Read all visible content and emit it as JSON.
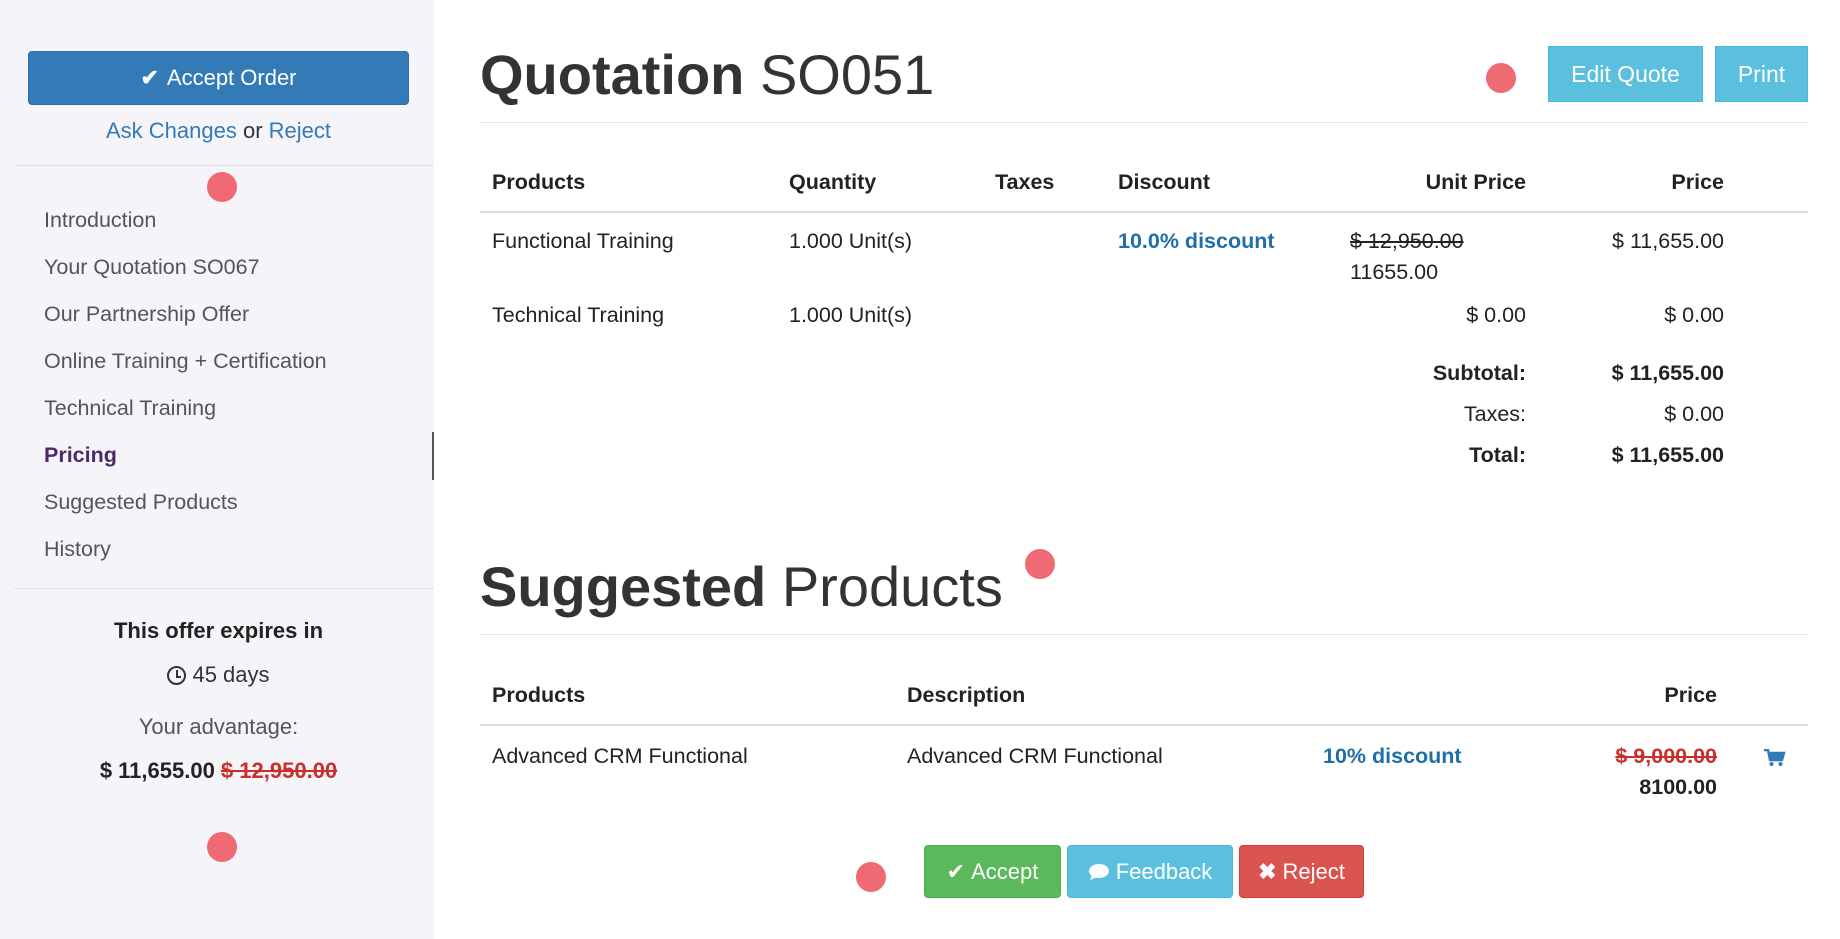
{
  "sidebar": {
    "accept_order_label": "Accept Order",
    "ask_changes_label": "Ask Changes",
    "or_text": "or",
    "reject_link_label": "Reject",
    "nav": [
      {
        "label": "Introduction",
        "active": false
      },
      {
        "label": "Your Quotation SO067",
        "active": false
      },
      {
        "label": "Our Partnership Offer",
        "active": false
      },
      {
        "label": "Online Training + Certification",
        "active": false
      },
      {
        "label": "Technical Training",
        "active": false
      },
      {
        "label": "Pricing",
        "active": true
      },
      {
        "label": "Suggested Products",
        "active": false
      },
      {
        "label": "History",
        "active": false
      }
    ],
    "expires_title": "This offer expires in",
    "expires_days": "45 days",
    "advantage_label": "Your advantage:",
    "price_now": "$ 11,655.00",
    "price_old": "$ 12,950.00"
  },
  "header": {
    "title_bold": "Quotation",
    "title_rest": "SO051",
    "edit_quote_label": "Edit Quote",
    "print_label": "Print"
  },
  "quote_table": {
    "columns": [
      "Products",
      "Quantity",
      "Taxes",
      "Discount",
      "Unit Price",
      "Price"
    ],
    "rows": [
      {
        "product": "Functional Training",
        "quantity": "1.000 Unit(s)",
        "taxes": "",
        "discount": "10.0% discount",
        "unit_price_old": "$ 12,950.00",
        "unit_price": "11655.00",
        "price": "$ 11,655.00"
      },
      {
        "product": "Technical Training",
        "quantity": "1.000 Unit(s)",
        "taxes": "",
        "discount": "",
        "unit_price_old": "",
        "unit_price": "$ 0.00",
        "price": "$ 0.00"
      }
    ],
    "subtotal_label": "Subtotal:",
    "subtotal": "$ 11,655.00",
    "taxes_label": "Taxes:",
    "taxes": "$ 0.00",
    "total_label": "Total:",
    "total": "$ 11,655.00"
  },
  "suggested": {
    "title_bold": "Suggested",
    "title_rest": "Products",
    "columns": [
      "Products",
      "Description",
      "Price"
    ],
    "rows": [
      {
        "product": "Advanced CRM Functional",
        "description": "Advanced CRM Functional",
        "discount": "10% discount",
        "price_old": "$ 9,000.00",
        "price": "8100.00"
      }
    ]
  },
  "actions": {
    "accept_label": "Accept",
    "feedback_label": "Feedback",
    "reject_label": "Reject"
  },
  "colors": {
    "primary": "#337ab7",
    "info": "#5bc0de",
    "success": "#5cb85c",
    "danger": "#d9534f",
    "marker": "#f06a74"
  }
}
